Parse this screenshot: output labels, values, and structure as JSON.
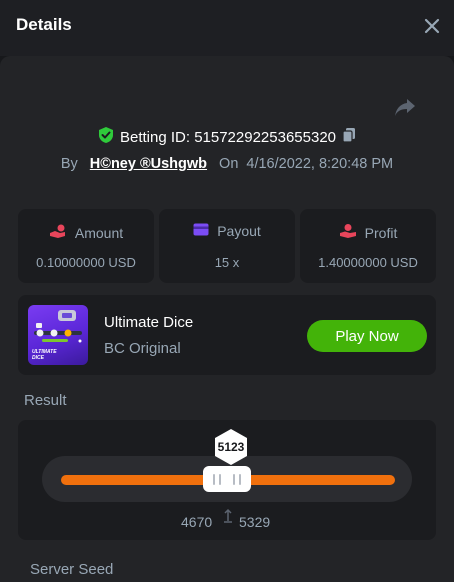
{
  "header": {
    "title": "Details",
    "close_icon": "close-icon"
  },
  "bet": {
    "label": "Betting ID: ",
    "id": "51572292253655320",
    "by_label": "By",
    "user": "H©ney ®Ushgwb",
    "on_label": "On",
    "datetime": "4/16/2022, 8:20:48 PM"
  },
  "stats": {
    "amount": {
      "label": "Amount",
      "value": "0.10000000 USD",
      "icon": "hand-coins-icon"
    },
    "payout": {
      "label": "Payout",
      "value": "15 x",
      "icon": "card-icon"
    },
    "profit": {
      "label": "Profit",
      "value": "1.40000000 USD",
      "icon": "hand-profit-icon"
    }
  },
  "game": {
    "name": "Ultimate Dice",
    "subtitle": "BC Original",
    "thumb_text": "ULTIMATE DICE",
    "play_label": "Play Now"
  },
  "result": {
    "label": "Result",
    "value": "5123",
    "range_low": "4670",
    "range_high": "5329"
  },
  "server_seed": {
    "label": "Server Seed"
  },
  "colors": {
    "accent_green": "#43b309",
    "slider_orange": "#f0700d",
    "shield_green": "#2fcb3b",
    "amount_icon": "#e8455b",
    "payout_icon": "#7b4cf5",
    "profit_icon": "#e8455b",
    "muted_text": "#98a7b5"
  }
}
